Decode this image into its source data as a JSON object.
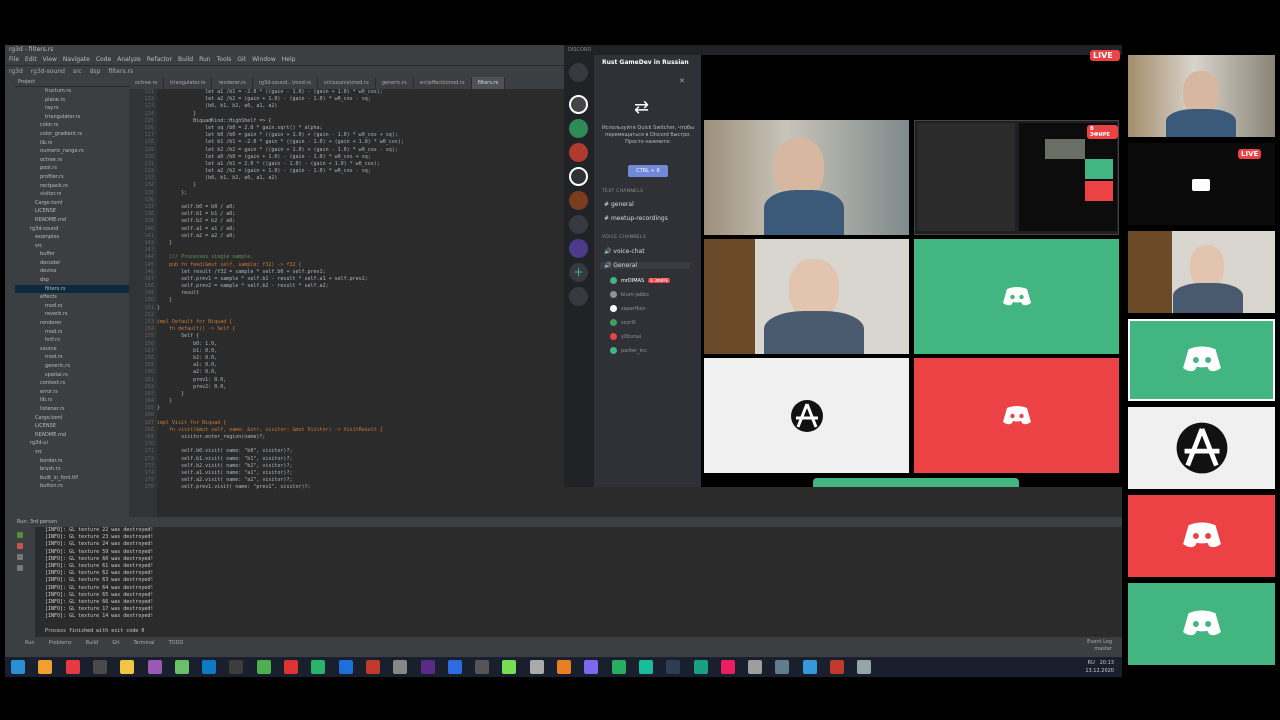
{
  "ide": {
    "title": "rg3d - filters.rs",
    "menu": [
      "File",
      "Edit",
      "View",
      "Navigate",
      "Code",
      "Analyze",
      "Refactor",
      "Build",
      "Run",
      "Tools",
      "Git",
      "Window",
      "Help"
    ],
    "nav": [
      "rg3d",
      "rg3d-sound",
      "src",
      "dsp",
      "filters.rs"
    ],
    "project_header": "Project",
    "tree": [
      "fructum.rs",
      "plane.rs",
      "ray.rs",
      "triangulator.rs",
      "color.rs",
      "color_gradient.rs",
      "lib.rs",
      "numeric_range.rs",
      "octree.rs",
      "pool.rs",
      "profiler.rs",
      "rectpack.rs",
      "visitor.rs",
      "Cargo.toml",
      "LICENSE",
      "README.md",
      "rg3d-sound",
      "examples",
      "src",
      "buffer",
      "decoder",
      "device",
      "dsp",
      "filters.rs",
      "effects",
      "mod.rs",
      "reverb.rs",
      "renderer",
      "mod.rs",
      "hrtf.rs",
      "source",
      "mod.rs",
      "generic.rs",
      "spatial.rs",
      "context.rs",
      "error.rs",
      "lib.rs",
      "listener.rs",
      "Cargo.toml",
      "LICENSE",
      "README.md",
      "rg3d-ui",
      "src",
      "border.rs",
      "brush.rs",
      "built_in_font.ttf",
      "button.rs"
    ],
    "tabs": [
      "octree.rs",
      "triangulator.rs",
      "renderer.rs",
      "rg3d-sound...\\mod.rs",
      "src\\source\\mod.rs",
      "generic.rs",
      "src\\effects\\mod.rs",
      "filters.rs"
    ],
    "code_lines": [
      "                let a1 /b1 = -2.0 * ((gain - 1.0) - (gain + 1.0) * w0_cos);",
      "                let a2 /b2 = (gain + 1.0) - (gain - 1.0) * w0_cos - sq;",
      "                (b0, b1, b2, a0, a1, a2)",
      "            }",
      "            BiquadKind::HighShelf => {",
      "                let sq /b0 = 2.0 * gain.sqrt() * alpha;",
      "                let b0 /b0 = gain * ((gain + 1.0) + (gain - 1.0) * w0_cos + sq);",
      "                let b1 /b1 = -2.0 * gain * ((gain - 1.0) + (gain + 1.0) * w0_cos);",
      "                let b2 /b2 = gain * ((gain + 1.0) + (gain - 1.0) * w0_cos - sq);",
      "                let a0 /b0 = (gain + 1.0) - (gain - 1.0) * w0_cos + sq;",
      "                let a1 /b1 = 2.0 * ((gain - 1.0) - (gain + 1.0) * w0_cos);",
      "                let a2 /b2 = (gain + 1.0) - (gain - 1.0) * w0_cos - sq;",
      "                (b0, b1, b2, a0, a1, a2)",
      "            }",
      "        };",
      "",
      "        self.b0 = b0 / a0;",
      "        self.b1 = b1 / a0;",
      "        self.b2 = b2 / a0;",
      "        self.a1 = a1 / a0;",
      "        self.a2 = a2 / a0;",
      "    }",
      "",
      "    /// Processes single sample.",
      "    pub fn feed(&mut self, sample: f32) -> f32 {",
      "        let result /f32 = sample * self.b0 + self.prev1;",
      "        self.prev1 = sample * self.b1 - result * self.a1 + self.prev2;",
      "        self.prev2 = sample * self.b2 - result * self.a2;",
      "        result",
      "    }",
      "}",
      "",
      "impl Default for Biquad {",
      "    fn default() -> Self {",
      "        Self {",
      "            b0: 1.0,",
      "            b1: 0.0,",
      "            b2: 0.0,",
      "            a1: 0.0,",
      "            a2: 0.0,",
      "            prev1: 0.0,",
      "            prev2: 0.0,",
      "        }",
      "    }",
      "}",
      "",
      "impl Visit for Biquad {",
      "    fn visit(&mut self, name: &str, visitor: &mut Visitor) -> VisitResult {",
      "        visitor.enter_region(name)?;",
      "",
      "        self.b0.visit( name: \"b0\", visitor)?;",
      "        self.b1.visit( name: \"b1\", visitor)?;",
      "        self.b2.visit( name: \"b2\", visitor)?;",
      "        self.a1.visit( name: \"a1\", visitor)?;",
      "        self.a2.visit( name: \"a2\", visitor)?;",
      "        self.prev1.visit( name: \"prev1\", visitor)?;"
    ],
    "first_line_number": 121,
    "run_header": "Run:  3rd person",
    "run_output": [
      "[INFO]: GL texture 22 was destroyed!",
      "[INFO]: GL texture 23 was destroyed!",
      "[INFO]: GL texture 24 was destroyed!",
      "[INFO]: GL texture 59 was destroyed!",
      "[INFO]: GL texture 60 was destroyed!",
      "[INFO]: GL texture 61 was destroyed!",
      "[INFO]: GL texture 62 was destroyed!",
      "[INFO]: GL texture 63 was destroyed!",
      "[INFO]: GL texture 64 was destroyed!",
      "[INFO]: GL texture 65 was destroyed!",
      "[INFO]: GL texture 66 was destroyed!",
      "[INFO]: GL texture 17 was destroyed!",
      "[INFO]: GL texture 14 was destroyed!",
      "",
      "Process finished with exit code 0"
    ],
    "status_tabs": [
      "Run",
      "Problems",
      "Build",
      "Git",
      "Terminal",
      "TODO"
    ],
    "status_right": [
      "Event Log",
      "master"
    ]
  },
  "taskbar": {
    "lang": "RU",
    "time": "20:13",
    "date": "13.12.2020"
  },
  "discord": {
    "title": "DISCORD",
    "server_name": "Rust GameDev in Russian",
    "quick_switcher_text": "Используйте Quick Switcher, чтобы перемещаться в Discord быстро. Просто нажмите:",
    "quick_switcher_key": "CTRL + K",
    "text_channels_label": "TEXT CHANNELS",
    "text_channels": [
      "general",
      "meetup-recordings"
    ],
    "voice_channels_label": "VOICE CHANNELS",
    "voice_channels": [
      "voice-chat",
      "General"
    ],
    "voice_users": [
      {
        "name": "mrDIMAS",
        "live": "В ЭФИРЕ",
        "color": "#43b581"
      },
      {
        "name": "blum-jabbs",
        "color": "#8e9297"
      },
      {
        "name": "zaperfkov",
        "color": "#ffffff"
      },
      {
        "name": "scorill",
        "color": "#3ba55c"
      },
      {
        "name": "y0bunai",
        "color": "#ed4245"
      },
      {
        "name": "parker_inc",
        "color": "#43b581"
      }
    ],
    "live_badge": "LIVE",
    "mini_live_badge": "В ЭФИРЕ"
  },
  "side_live_badge": "LIVE",
  "colors": {
    "discord_green": "#43b581",
    "discord_red": "#ed4245",
    "discord_blurple": "#7289da"
  }
}
